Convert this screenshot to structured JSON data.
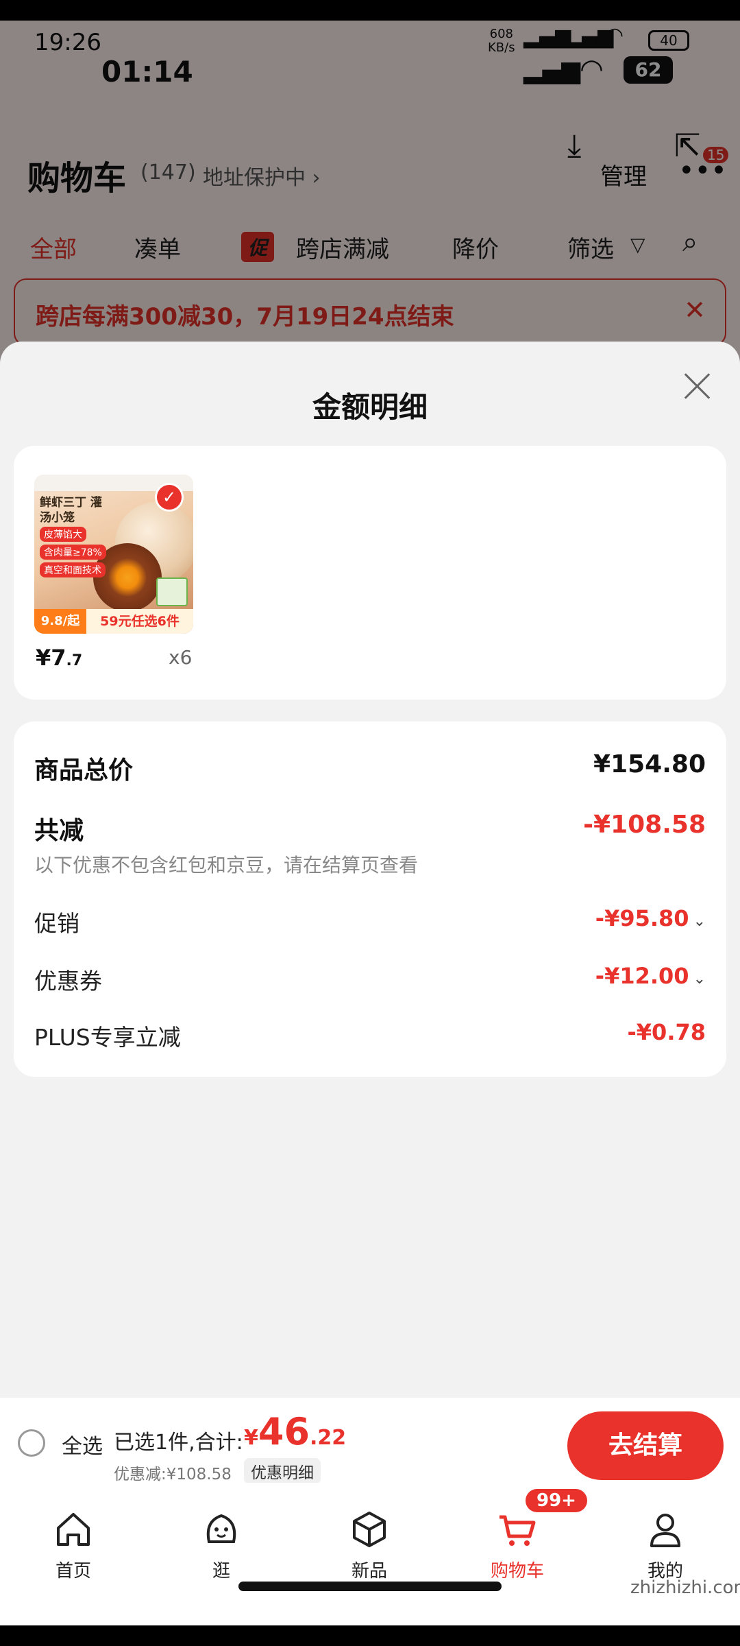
{
  "status": {
    "time_small": "19:26",
    "time_big": "01:14",
    "net_speed": "608",
    "net_unit": "KB/s",
    "battery_small": "40",
    "battery_big": "62"
  },
  "cart": {
    "title": "购物车",
    "count": "(147)",
    "address": "地址保护中 ›",
    "manage": "管理",
    "more_badge": "15",
    "filters": [
      "全部",
      "凑单",
      "促",
      "跨店满减",
      "降价",
      "筛选"
    ],
    "banner": "跨店每满300减30，7月19日24点结束"
  },
  "sheet": {
    "title": "金额明细",
    "item": {
      "thumb_title": "鲜虾三丁 灌汤小笼",
      "thumb_tags": [
        "皮薄馅大",
        "含肉量≥78%",
        "真空和面技术"
      ],
      "thumb_price": "9.8/起",
      "thumb_deal": "59元任选6件",
      "price_int": "¥7",
      "price_dec": ".7",
      "qty": "x6"
    },
    "summary": {
      "total_label": "商品总价",
      "total_value": "¥154.80",
      "reduce_label": "共减",
      "reduce_value": "-¥108.58",
      "note": "以下优惠不包含红包和京豆，请在结算页查看",
      "promo_label": "促销",
      "promo_value": "-¥95.80",
      "coupon_label": "优惠券",
      "coupon_value": "-¥12.00",
      "plus_label": "PLUS专享立减",
      "plus_value": "-¥0.78"
    }
  },
  "checkout": {
    "select_all": "全选",
    "selected": "已选1件,合计:",
    "currency": "¥",
    "total_int": "46",
    "total_dec": ".22",
    "discount": "优惠减:¥108.58",
    "detail_btn": "优惠明细",
    "pay_btn": "去结算"
  },
  "tabs": [
    {
      "label": "首页",
      "icon": "home-icon"
    },
    {
      "label": "逛",
      "icon": "face-icon"
    },
    {
      "label": "新品",
      "icon": "box-icon"
    },
    {
      "label": "购物车",
      "icon": "cart-icon"
    },
    {
      "label": "我的",
      "icon": "person-icon"
    }
  ],
  "cart_badge": "99+",
  "watermark": "zhizhizhi.com",
  "colors": {
    "accent": "#e8322b",
    "sheet_bg": "#f2f2f2"
  }
}
